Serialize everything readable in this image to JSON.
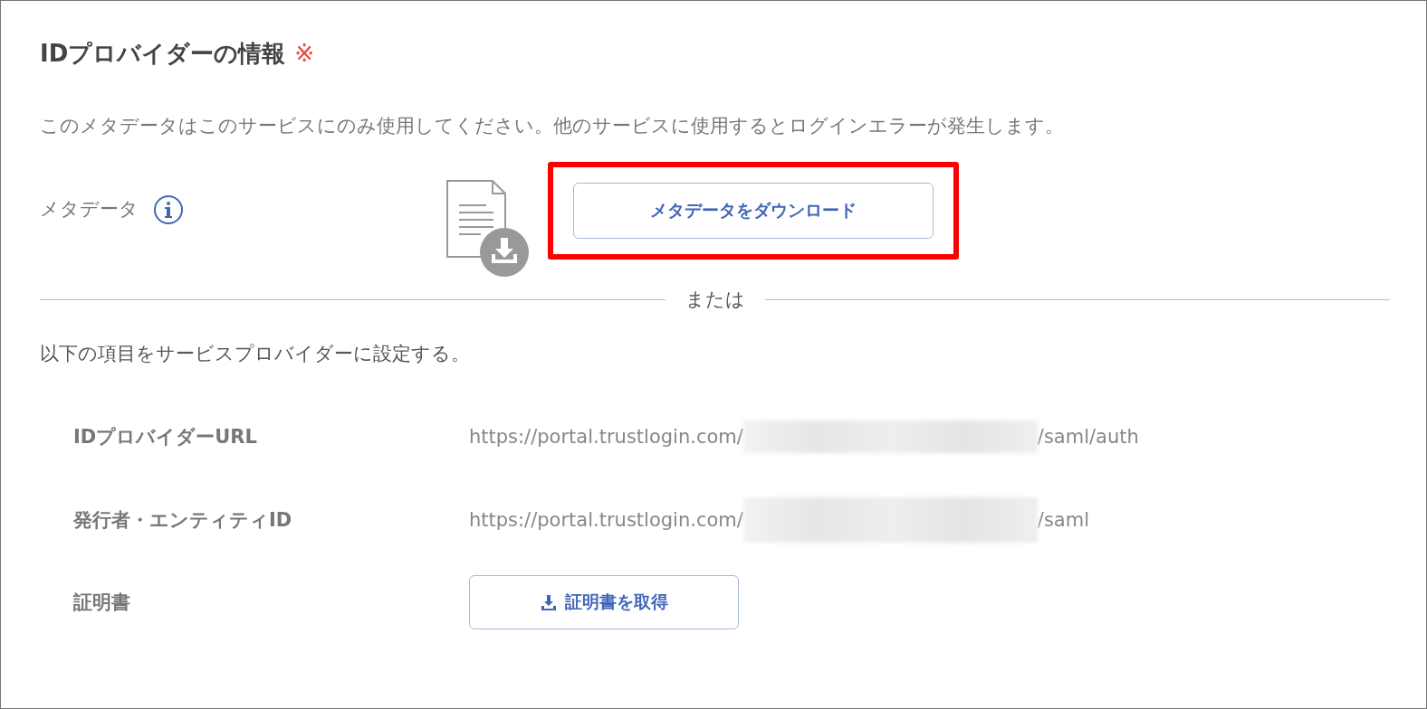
{
  "title": "IDプロバイダーの情報",
  "required_mark": "※",
  "notice": "このメタデータはこのサービスにのみ使用してください。他のサービスに使用するとログインエラーが発生します。",
  "metadata": {
    "label": "メタデータ",
    "button": "メタデータをダウンロード",
    "highlighted": true
  },
  "divider": "または",
  "instruction": "以下の項目をサービスプロバイダーに設定する。",
  "fields": [
    {
      "kind": "url",
      "label": "IDプロバイダーURL",
      "value_start": "https://portal.trustlogin.com/",
      "value_end": "/saml/auth"
    },
    {
      "kind": "url",
      "label": "発行者・エンティティID",
      "value_start": "https://portal.trustlogin.com/",
      "value_end": "/saml"
    },
    {
      "kind": "button",
      "label": "証明書",
      "button": "証明書を取得"
    }
  ]
}
